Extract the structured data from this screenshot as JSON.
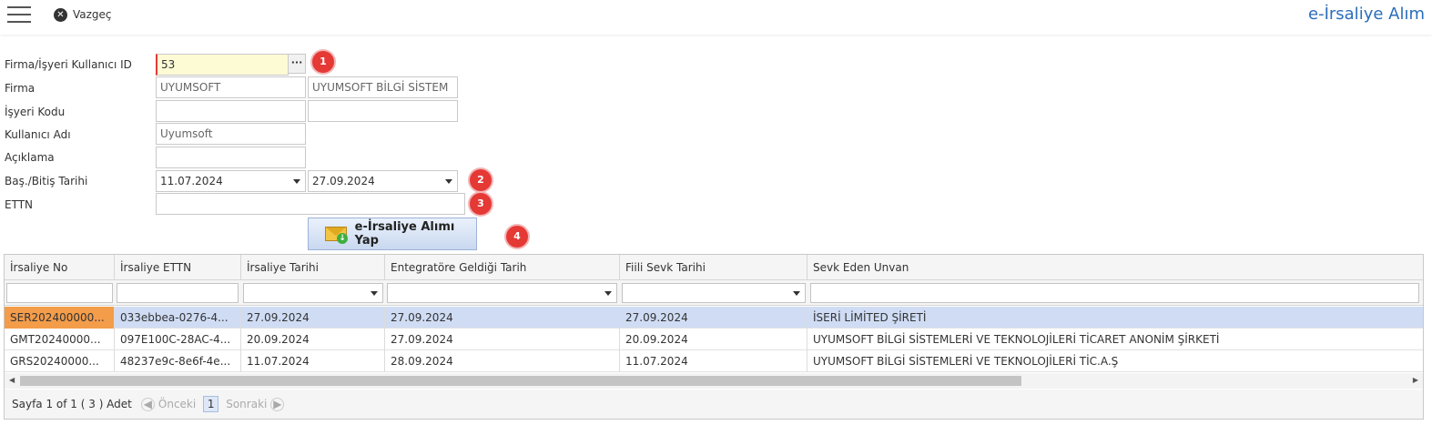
{
  "header": {
    "cancel_label": "Vazgeç",
    "title": "e-İrsaliye Alım"
  },
  "form": {
    "firma_kullanici_label": "Firma/İşyeri Kullanıcı ID",
    "firma_kullanici_value": "53",
    "firma_label": "Firma",
    "firma_code": "UYUMSOFT",
    "firma_name": "UYUMSOFT BİLGİ SİSTEM",
    "isyeri_kodu_label": "İşyeri Kodu",
    "isyeri_kodu_value": "",
    "isyeri_kodu_name": "",
    "kullanici_adi_label": "Kullanıcı Adı",
    "kullanici_adi_value": "Uyumsoft",
    "aciklama_label": "Açıklama",
    "aciklama_value": "",
    "tarih_label": "Baş./Bitiş Tarihi",
    "bas_tarihi": "11.07.2024",
    "bitis_tarihi": "27.09.2024",
    "ettn_label": "ETTN",
    "ettn_value": "",
    "action_button": "e-İrsaliye Alımı Yap",
    "dots": "···"
  },
  "badges": [
    "1",
    "2",
    "3",
    "4"
  ],
  "grid": {
    "columns": [
      "İrsaliye No",
      "İrsaliye ETTN",
      "İrsaliye Tarihi",
      "Entegratöre Geldiği Tarih",
      "Fiili Sevk Tarihi",
      "Sevk Eden Unvan"
    ],
    "rows": [
      [
        "SER202400000...",
        "033ebbea-0276-4...",
        "27.09.2024",
        "27.09.2024",
        "27.09.2024",
        "İSERİ LİMİTED ŞİRETİ"
      ],
      [
        "GMT20240000...",
        "097E100C-28AC-4...",
        "20.09.2024",
        "27.09.2024",
        "20.09.2024",
        "UYUMSOFT BİLGİ SİSTEMLERİ VE TEKNOLOJİLERİ TİCARET ANONİM ŞİRKETİ"
      ],
      [
        "GRS20240000...",
        "48237e9c-8e6f-4e...",
        "11.07.2024",
        "28.09.2024",
        "11.07.2024",
        "UYUMSOFT BİLGİ SİSTEMLERİ VE TEKNOLOJİLERİ TİC.A.Ş"
      ]
    ],
    "selected_row": 0
  },
  "pager": {
    "summary": "Sayfa 1 of 1 ( 3 ) Adet",
    "prev_label": "Önceki",
    "page": "1",
    "next_label": "Sonraki"
  },
  "colors": {
    "accent": "#2a6ebb",
    "badge": "#e53935",
    "selected_row": "#cfdcf4",
    "highlight_cell": "#f39c4a"
  }
}
